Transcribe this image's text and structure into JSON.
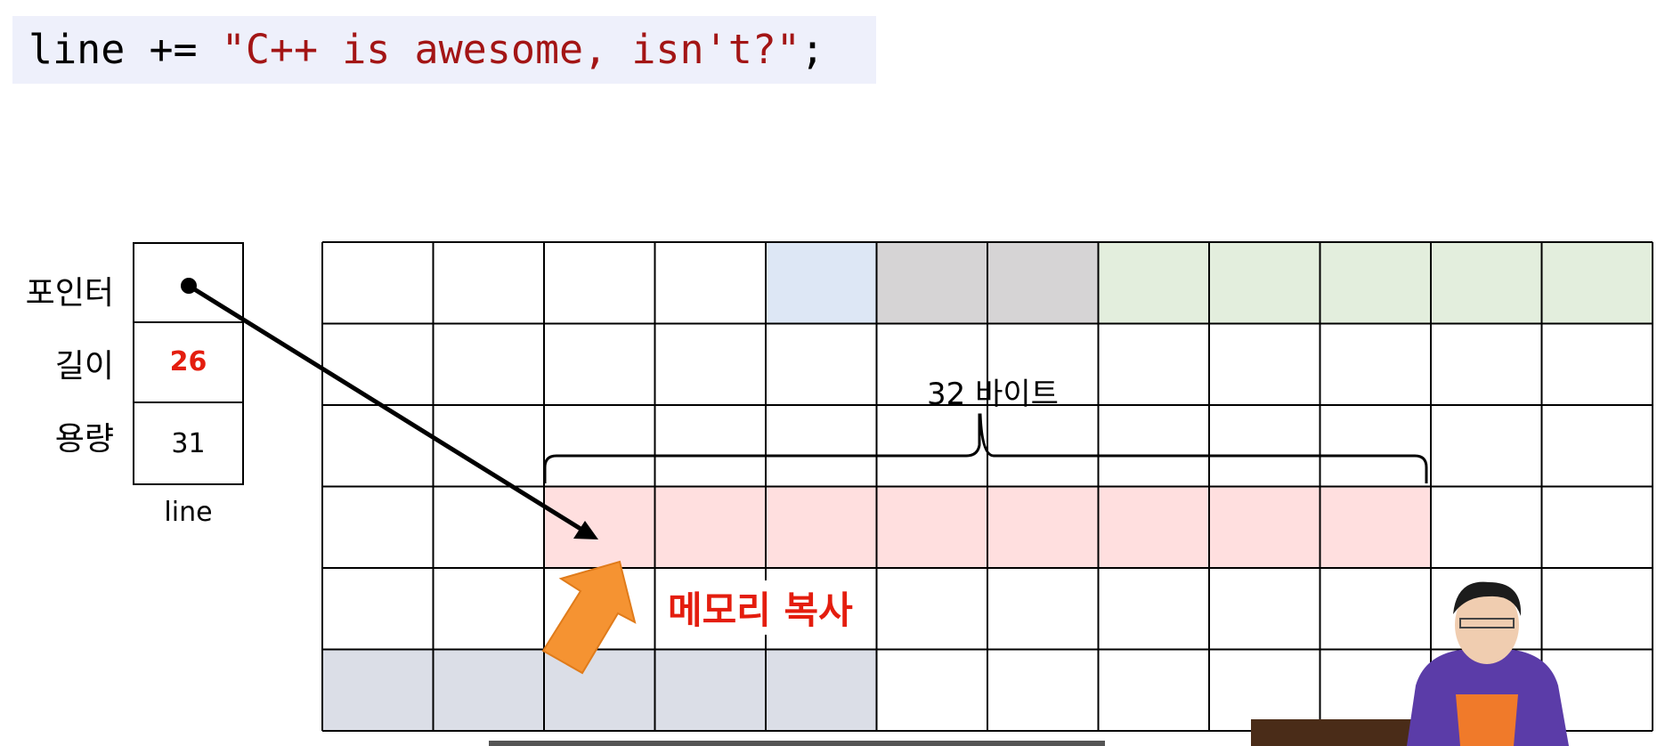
{
  "code": {
    "prefix": "line += ",
    "string": "\"C++ is awesome, isn't?\"",
    "suffix": ";"
  },
  "variable": {
    "name": "line",
    "fields": [
      {
        "label": "포인터",
        "value": ""
      },
      {
        "label": "길이",
        "value": "26"
      },
      {
        "label": "용량",
        "value": "31"
      }
    ]
  },
  "memory": {
    "columns": 12,
    "rows": 6,
    "colors": {
      "blue": "#dde7f5",
      "gray": "#d6d4d5",
      "green": "#e3eedd",
      "pink": "#ffdfdf",
      "slate": "#dbdee7",
      "white": "#ffffff"
    },
    "cells": [
      [
        "white",
        "white",
        "white",
        "white",
        "blue",
        "gray",
        "gray",
        "green",
        "green",
        "green",
        "green",
        "green"
      ],
      [
        "white",
        "white",
        "white",
        "white",
        "white",
        "white",
        "white",
        "white",
        "white",
        "white",
        "white",
        "white"
      ],
      [
        "white",
        "white",
        "white",
        "white",
        "white",
        "white",
        "white",
        "white",
        "white",
        "white",
        "white",
        "white"
      ],
      [
        "white",
        "white",
        "pink",
        "pink",
        "pink",
        "pink",
        "pink",
        "pink",
        "pink",
        "pink",
        "white",
        "white"
      ],
      [
        "white",
        "white",
        "white",
        "white",
        "white",
        "white",
        "white",
        "white",
        "white",
        "white",
        "white",
        "white"
      ],
      [
        "slate",
        "slate",
        "slate",
        "slate",
        "slate",
        "white",
        "white",
        "white",
        "white",
        "white",
        "white",
        "white"
      ]
    ]
  },
  "annotations": {
    "block_size": "32 바이트",
    "copy_label": "메모리 복사"
  },
  "colors": {
    "code_background": "#eef0fb",
    "string_literal": "#a31515",
    "highlight_red": "#e41d0e",
    "arrow_orange": "#f59332"
  },
  "icons": {
    "pointer_dot": "filled-circle",
    "pointer_arrow": "black-arrow",
    "copy_arrow": "orange-block-arrow",
    "brace": "curly-brace"
  }
}
